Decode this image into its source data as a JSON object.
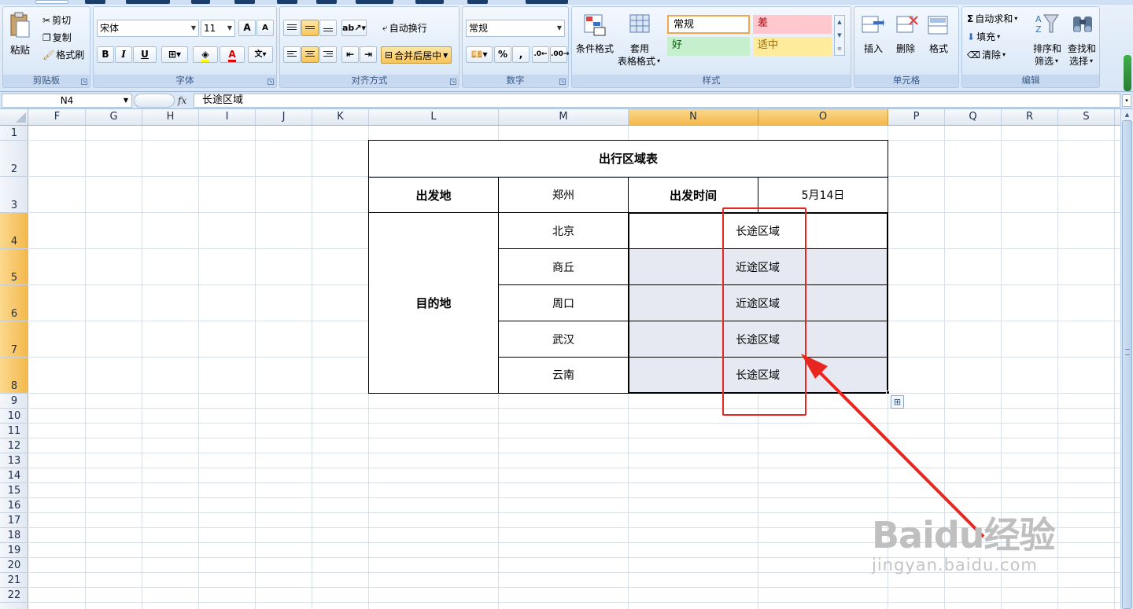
{
  "ribbon": {
    "clipboard": {
      "group_label": "剪贴板",
      "paste": "粘贴",
      "cut": "剪切",
      "copy": "复制",
      "format_painter": "格式刷"
    },
    "font": {
      "group_label": "字体",
      "font_name": "宋体",
      "font_size": "11",
      "bold": "B",
      "italic": "I",
      "underline": "U",
      "grow": "A",
      "shrink": "A"
    },
    "alignment": {
      "group_label": "对齐方式",
      "wrap_text": "自动换行",
      "merge_center": "合并后居中"
    },
    "number": {
      "group_label": "数字",
      "format": "常规",
      "percent": "%",
      "comma": ","
    },
    "styles": {
      "group_label": "样式",
      "conditional": "条件格式",
      "table_format_1": "套用",
      "table_format_2": "表格格式",
      "normal": "常规",
      "bad": "差",
      "good": "好",
      "neutral": "适中"
    },
    "cells": {
      "group_label": "单元格",
      "insert": "插入",
      "delete": "删除",
      "format": "格式"
    },
    "editing": {
      "group_label": "编辑",
      "autosum": "自动求和",
      "fill": "填充",
      "clear": "清除",
      "sort_filter_1": "排序和",
      "sort_filter_2": "筛选",
      "find_select_1": "查找和",
      "find_select_2": "选择"
    }
  },
  "formula_bar": {
    "name_box": "N4",
    "fx": "fx",
    "content": "长途区域"
  },
  "columns": [
    "F",
    "G",
    "H",
    "I",
    "J",
    "K",
    "L",
    "M",
    "N",
    "O",
    "P",
    "Q",
    "R",
    "S"
  ],
  "selected_columns": [
    "N",
    "O"
  ],
  "rows": [
    "1",
    "2",
    "3",
    "4",
    "5",
    "6",
    "7",
    "8",
    "9",
    "10",
    "11",
    "12",
    "13",
    "14",
    "15",
    "16",
    "17",
    "18",
    "19",
    "20",
    "21",
    "22"
  ],
  "selected_rows": [
    "4",
    "5",
    "6",
    "7",
    "8"
  ],
  "table": {
    "title": "出行区域表",
    "origin_label": "出发地",
    "origin_value": "郑州",
    "depart_time_label": "出发时间",
    "depart_time_value": "5月14日",
    "destination_label": "目的地",
    "destinations": [
      {
        "city": "北京",
        "region": "长途区域"
      },
      {
        "city": "商丘",
        "region": "近途区域"
      },
      {
        "city": "周口",
        "region": "近途区域"
      },
      {
        "city": "武汉",
        "region": "长途区域"
      },
      {
        "city": "云南",
        "region": "长途区域"
      }
    ]
  },
  "watermark": {
    "logo": "Baidu经验",
    "url": "jingyan.baidu.com"
  },
  "colors": {
    "annotation": "#e8261f",
    "selection_header": "#f3b84b",
    "selection_fill": "#e6e9f2",
    "style_bad": "#ffc7ce",
    "style_good": "#c6efce",
    "style_neutral": "#ffeb9c"
  }
}
